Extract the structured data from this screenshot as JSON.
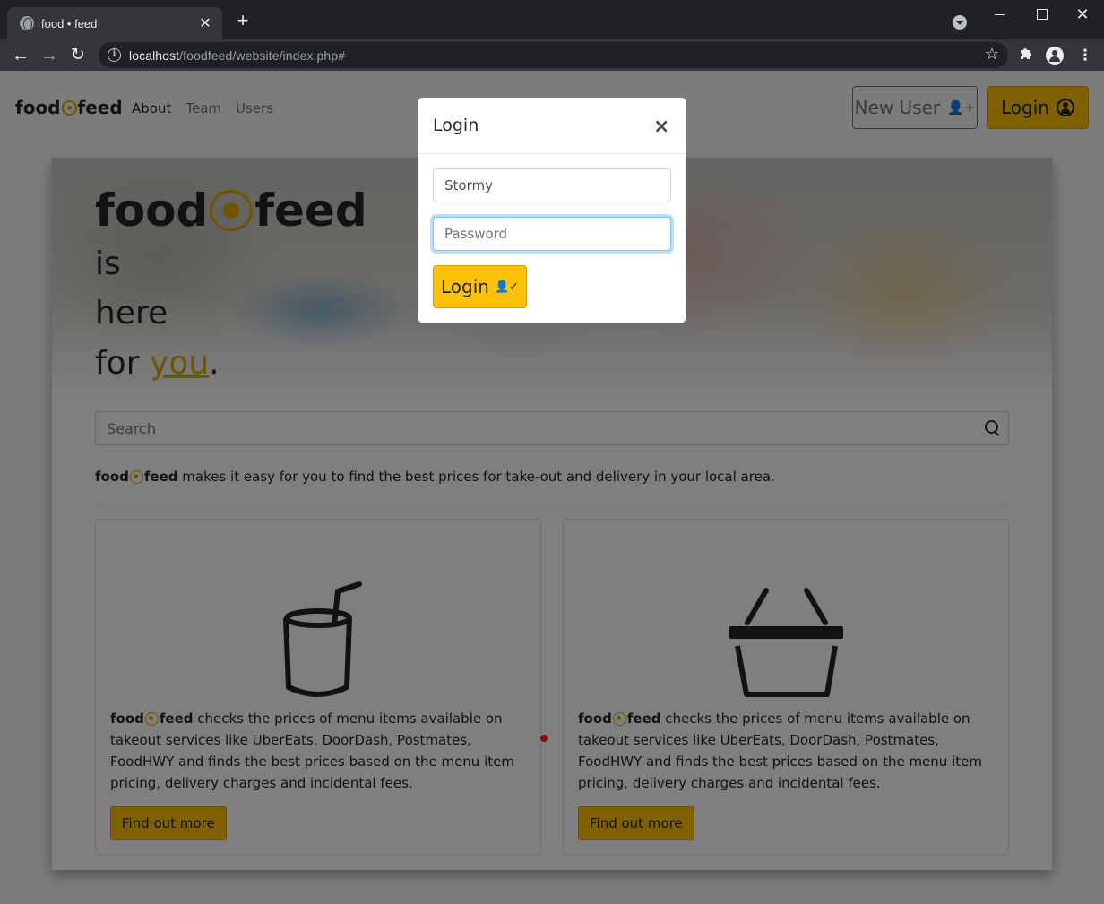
{
  "browser": {
    "tab_title": "food • feed",
    "tab_close": "✕",
    "new_tab": "+",
    "url_host": "localhost",
    "url_path": "/foodfeed/website/index.php#",
    "win_close": "✕"
  },
  "navbar": {
    "brand_left": "food",
    "brand_right": "feed",
    "links": [
      "About",
      "Team",
      "Users"
    ],
    "new_user_label": "New User",
    "login_label": "Login"
  },
  "hero": {
    "brand_left": "food",
    "brand_right": "feed",
    "line1": "is",
    "line2": "here",
    "line3_prefix": "for ",
    "line3_emph": "you",
    "line3_suffix": "."
  },
  "search": {
    "placeholder": "Search"
  },
  "tagline": {
    "brand_left": "food",
    "brand_right": "feed",
    "text": " makes it easy for you to find the best prices for take-out and delivery in your local area."
  },
  "cards": [
    {
      "icon": "cup-straw-icon",
      "brand_left": "food",
      "brand_right": "feed",
      "text": " checks the prices of menu items available on takeout services like UberEats, DoorDash, Postmates, FoodHWY and finds the best prices based on the menu item pricing, delivery charges and incidental fees.",
      "button": "Find out more"
    },
    {
      "icon": "basket-icon",
      "brand_left": "food",
      "brand_right": "feed",
      "text": " checks the prices of menu items available on takeout services like UberEats, DoorDash, Postmates, FoodHWY and finds the best prices based on the menu item pricing, delivery charges and incidental fees.",
      "button": "Find out more"
    }
  ],
  "modal": {
    "title": "Login",
    "close": "×",
    "username_value": "Stormy",
    "password_placeholder": "Password",
    "submit_label": "Login"
  },
  "colors": {
    "accent": "#ffc107",
    "accent_dark": "#e0a800"
  }
}
